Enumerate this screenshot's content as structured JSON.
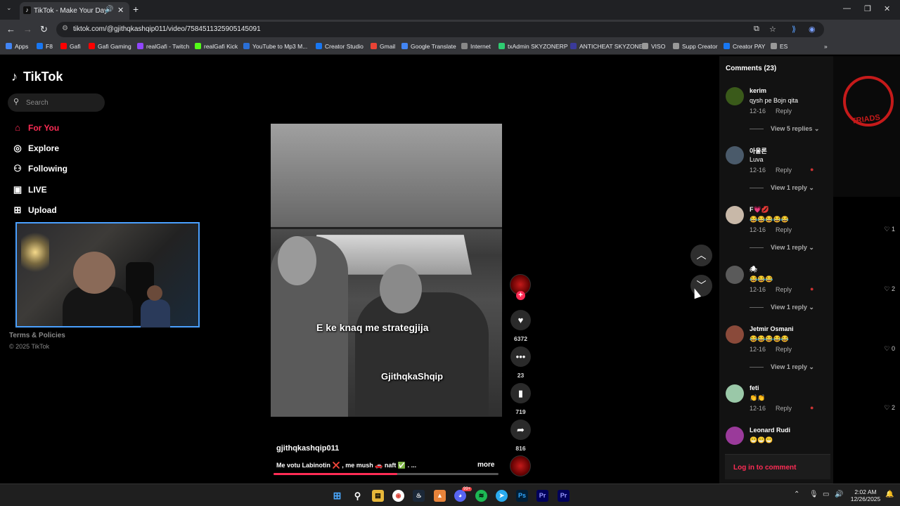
{
  "browser": {
    "tab_title": "TikTok - Make Your Day",
    "tab_icon": "tiktok-icon",
    "url": "tiktok.com/@gjithqkashqip011/video/7584511325905145091",
    "bookmarks": [
      {
        "label": "Apps",
        "color": "#4285f4"
      },
      {
        "label": "F8",
        "color": "#1877f2"
      },
      {
        "label": "Gafi",
        "color": "#ff0000"
      },
      {
        "label": "Gafi Gaming",
        "color": "#ff0000"
      },
      {
        "label": "realGafi - Twitch",
        "color": "#9146ff"
      },
      {
        "label": "realGafi Kick",
        "color": "#53fc18"
      },
      {
        "label": "YouTube to Mp3 M...",
        "color": "#2a6fd6"
      },
      {
        "label": "Creator Studio",
        "color": "#1877f2"
      },
      {
        "label": "Gmail",
        "color": "#ea4335"
      },
      {
        "label": "Google Translate",
        "color": "#4285f4"
      },
      {
        "label": "Internet",
        "color": "#888888"
      },
      {
        "label": "txAdmin SKYZONERP",
        "color": "#2ecc71"
      },
      {
        "label": "ANTICHEAT SKYZONE",
        "color": "#3a3a9a"
      },
      {
        "label": "VISO",
        "color": "#999999"
      },
      {
        "label": "Supp Creator",
        "color": "#999999"
      },
      {
        "label": "Creator PAY",
        "color": "#1877f2"
      },
      {
        "label": "ES",
        "color": "#999999"
      }
    ]
  },
  "tiktok": {
    "brand": "TikTok",
    "search_placeholder": "Search",
    "nav": [
      {
        "label": "For You",
        "icon": "home-icon",
        "active": true
      },
      {
        "label": "Explore",
        "icon": "compass-icon",
        "active": false
      },
      {
        "label": "Following",
        "icon": "people-icon",
        "active": false
      },
      {
        "label": "LIVE",
        "icon": "live-icon",
        "active": false
      },
      {
        "label": "Upload",
        "icon": "upload-icon",
        "active": false
      }
    ],
    "footer_terms": "Terms & Policies",
    "footer_copyright": "© 2025 TikTok"
  },
  "video": {
    "caption_1": "E ke knaq me strategjija",
    "caption_2": "GjithqkaShqip",
    "author": "gjithqkashqip011",
    "description": "Me votu Labinotin ❌ , me mush 🚗 naft ✅ . ...",
    "more_label": "more",
    "progress": 0.55,
    "likes": "6372",
    "comments": "23",
    "saves": "719",
    "shares": "816"
  },
  "comments": {
    "title": "Comments (23)",
    "login_label": "Log in to comment",
    "items": [
      {
        "name": "kerim",
        "text": "qysh pe Bojn qita",
        "date": "12-16",
        "reply": "Reply",
        "likes": "",
        "view": "View 5 replies",
        "avatar": "#3a5a1a"
      },
      {
        "name": "아울론",
        "text": "Luva",
        "date": "12-16",
        "reply": "Reply",
        "likes": "",
        "view": "View 1 reply",
        "avatar": "#4a5a6a",
        "creator_liked": true
      },
      {
        "name": "F💗💋",
        "text": "😂😂😂😂😂",
        "date": "12-16",
        "reply": "Reply",
        "likes": "1",
        "view": "View 1 reply",
        "avatar": "#c8b8a8"
      },
      {
        "name": "🕷",
        "text": "😂😂😂",
        "date": "12-16",
        "reply": "Reply",
        "likes": "2",
        "view": "View 1 reply",
        "avatar": "#5a5a5a",
        "creator_liked": true
      },
      {
        "name": "Jetmir Osmani",
        "text": "😂😂😂😂😂",
        "date": "12-16",
        "reply": "Reply",
        "likes": "0",
        "view": "View 1 reply",
        "avatar": "#8a4a3a"
      },
      {
        "name": "feti",
        "text": "👏👏",
        "date": "12-16",
        "reply": "Reply",
        "likes": "2",
        "view": "",
        "avatar": "#9ac8a8",
        "creator_liked": true
      },
      {
        "name": "Leonard Rudi",
        "text": "😁😁😁",
        "date": "",
        "reply": "",
        "likes": "",
        "view": "",
        "avatar": "#9a3a9a"
      }
    ]
  },
  "taskbar": {
    "time": "2:02 AM",
    "date": "12/26/2025",
    "discord_badge": "99+"
  }
}
